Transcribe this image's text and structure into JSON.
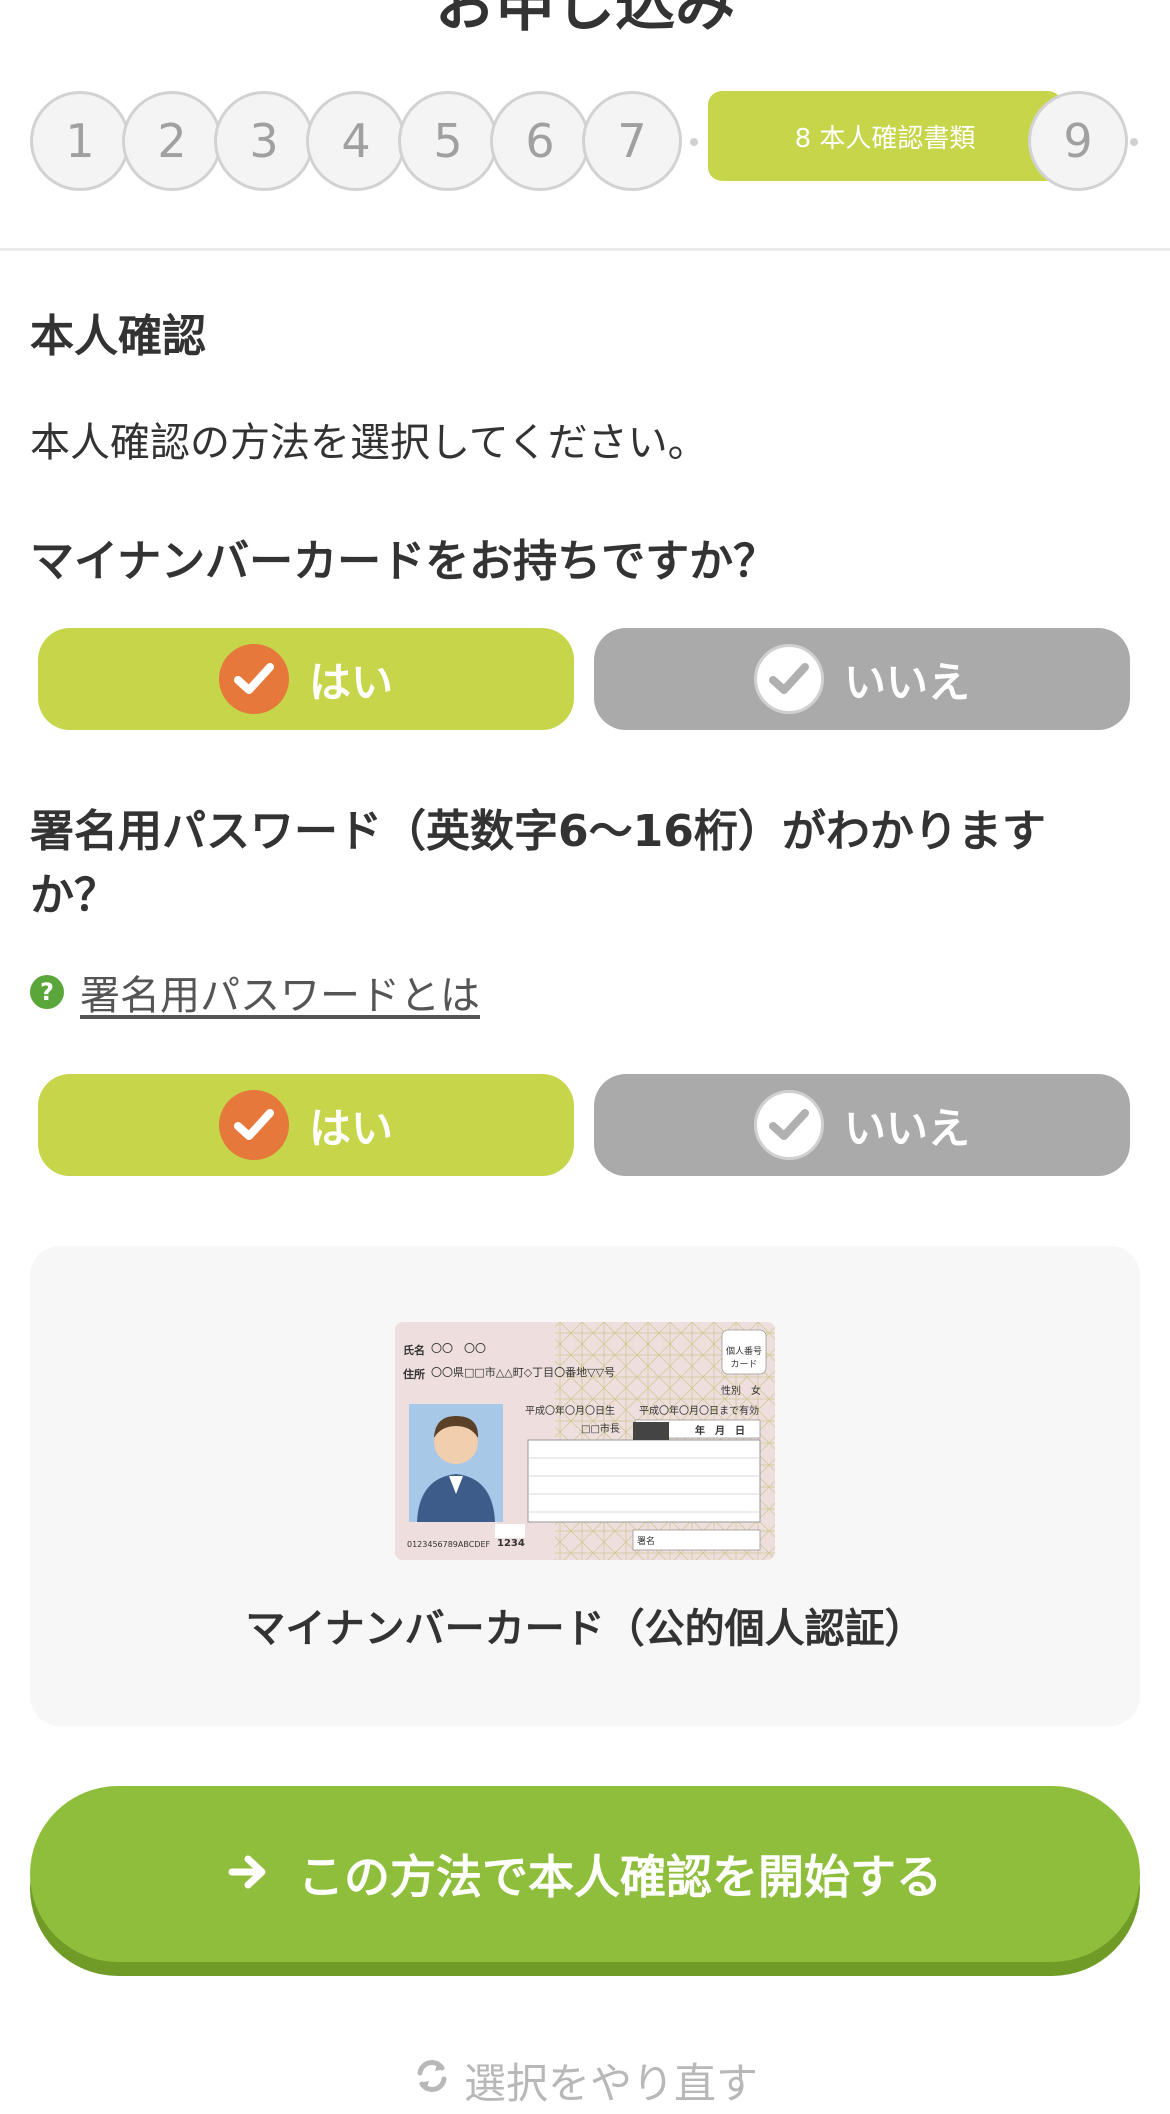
{
  "page": {
    "title": "お申し込み"
  },
  "stepper": {
    "steps": [
      "1",
      "2",
      "3",
      "4",
      "5",
      "6",
      "7"
    ],
    "active_label": "8 本人確認書類",
    "last_step": "9"
  },
  "section": {
    "heading": "本人確認",
    "instruction": "本人確認の方法を選択してください。"
  },
  "question1": {
    "text": "マイナンバーカードをお持ちですか？",
    "yes": "はい",
    "no": "いいえ"
  },
  "question2": {
    "text": "署名用パスワード（英数字6〜16桁）がわかりますか？",
    "help_mark": "?",
    "help_link": "署名用パスワードとは",
    "yes": "はい",
    "no": "いいえ"
  },
  "card": {
    "caption": "マイナンバーカード（公的個人認証）",
    "image": {
      "name_label": "氏名",
      "name_value": "〇〇　〇〇",
      "address_label": "住所",
      "address_value": "〇〇県□□市△△町◇丁目〇番地▽▽号",
      "badge": "個人番号カード",
      "sex_label": "性別",
      "sex_value": "女",
      "dob": "平成〇年〇月〇日生",
      "expiry": "平成〇年〇月〇日まで有効",
      "issuer": "□□市長",
      "date_header": "年　月　日",
      "serial": "0123456789ABCDEF",
      "code": "1234",
      "signature": "署名"
    }
  },
  "actions": {
    "start": "この方法で本人確認を開始する",
    "redo": "選択をやり直す"
  },
  "colors": {
    "accent_green": "#c7d54a",
    "start_green": "#8fbe3c",
    "check_orange": "#e5783a",
    "inactive_gray": "#aaaaaa"
  }
}
